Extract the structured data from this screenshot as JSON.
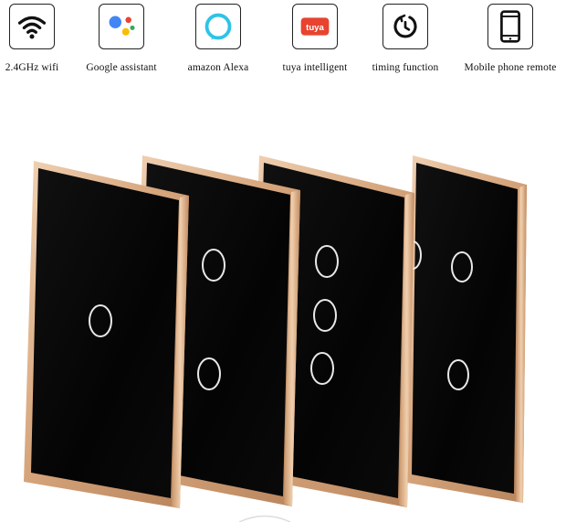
{
  "features": [
    {
      "label": "2.4GHz wifi",
      "icon": "wifi-icon"
    },
    {
      "label": "Google assistant",
      "icon": "google-assistant-icon"
    },
    {
      "label": "amazon Alexa",
      "icon": "alexa-icon"
    },
    {
      "label": "tuya intelligent",
      "icon": "tuya-logo-icon",
      "logo_text": "tuya"
    },
    {
      "label": "timing function",
      "icon": "timer-icon"
    },
    {
      "label": "Mobile phone remote",
      "icon": "smartphone-icon"
    }
  ],
  "colors": {
    "frame_gold": "#d6a57c",
    "frame_highlight": "#f1d2b4",
    "glass": "#050505",
    "touch_ring": "#e8e8e8",
    "tuya_red": "#e8432e",
    "google_blue": "#4285f4",
    "google_red": "#ea4335",
    "google_yellow": "#fbbc05",
    "google_green": "#34a853",
    "alexa_cyan": "#2ec3e6"
  },
  "switch_panels": [
    {
      "gangs": 1
    },
    {
      "gangs": 2
    },
    {
      "gangs": 3
    },
    {
      "gangs": 2
    }
  ]
}
